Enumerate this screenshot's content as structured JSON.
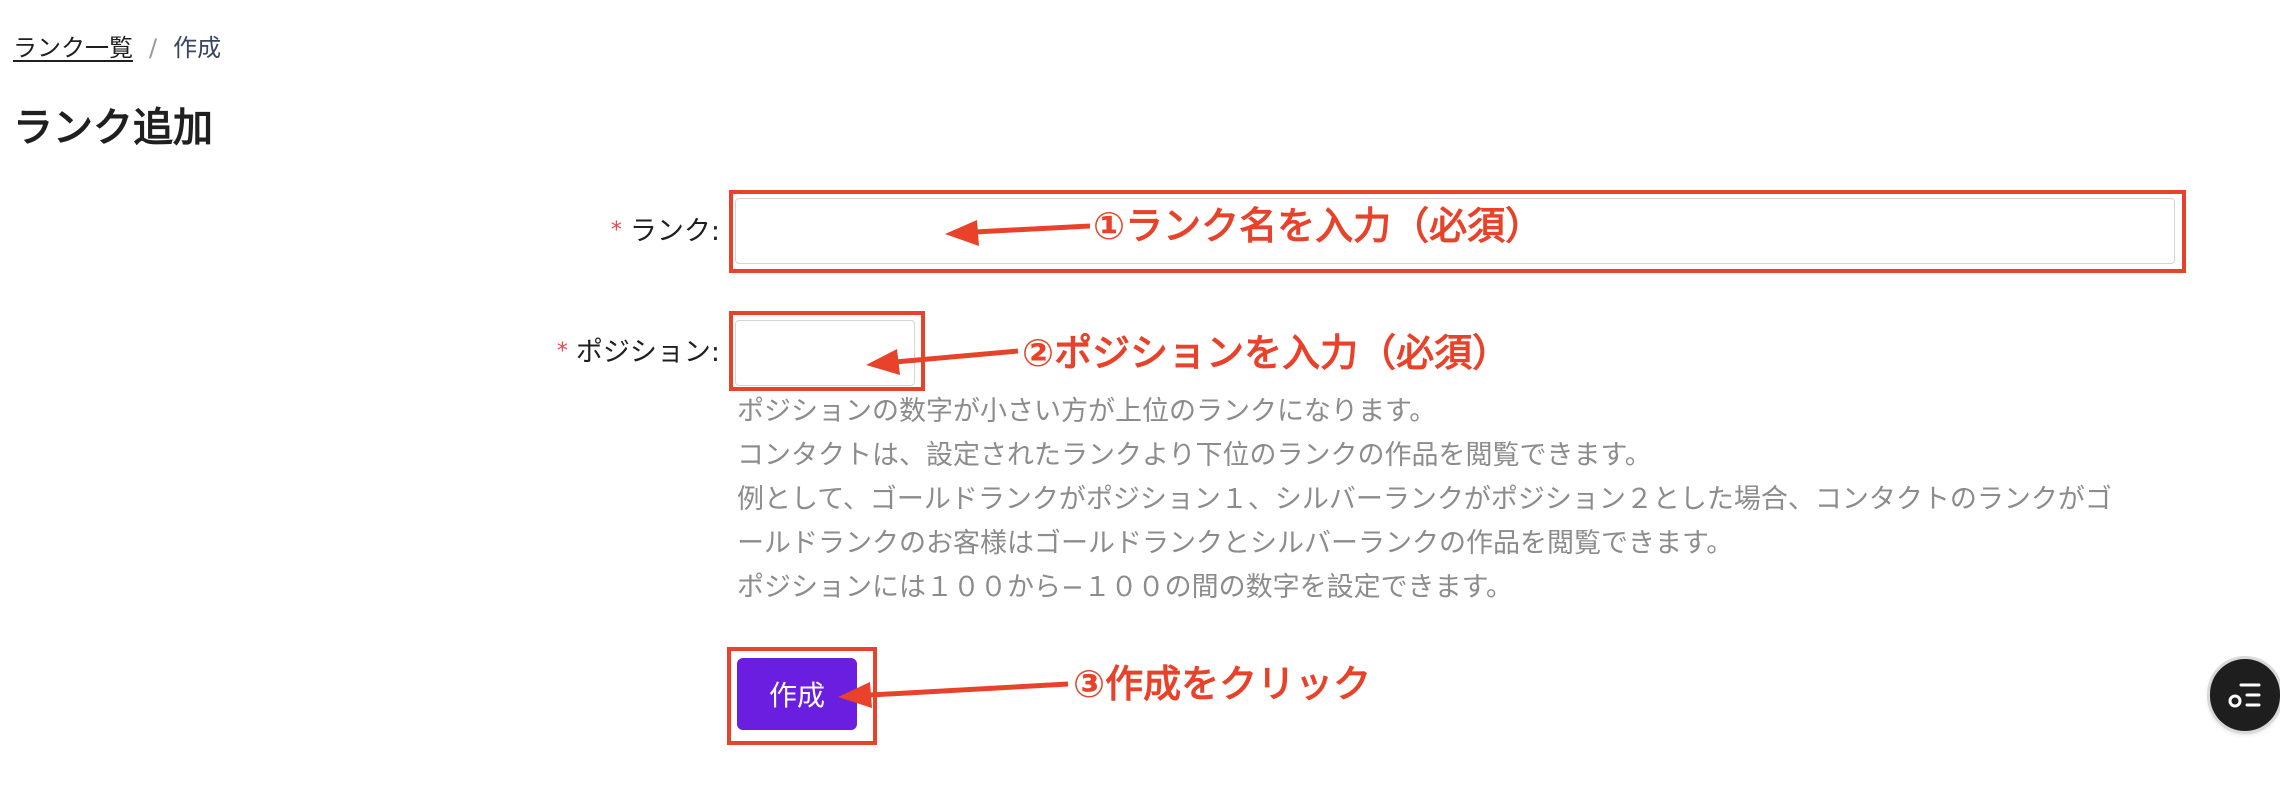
{
  "breadcrumb": {
    "parent": "ランク一覧",
    "separator": "/",
    "current": "作成"
  },
  "page_title": "ランク追加",
  "form": {
    "required_mark": "*",
    "rank_label": "ランク:",
    "rank_value": "",
    "position_label": "ポジション:",
    "position_value": "",
    "help_lines": [
      "ポジションの数字が小さい方が上位のランクになります。",
      "コンタクトは、設定されたランクより下位のランクの作品を閲覧できます。",
      "例として、ゴールドランクがポジション１、シルバーランクがポジション２とした場合、コンタクトのランクがゴ",
      "ールドランクのお客様はゴールドランクとシルバーランクの作品を閲覧できます。",
      "ポジションには１００から−１００の間の数字を設定できます。"
    ],
    "submit_label": "作成"
  },
  "annotations": {
    "step1": "①ランク名を入力（必須）",
    "step2": "②ポジションを入力（必須）",
    "step3": "③作成をクリック"
  },
  "colors": {
    "accent": "#6a1ee0",
    "annotation": "#e8432a",
    "required": "#e5484d",
    "help_text": "#8c8c8c"
  },
  "icons": {
    "floating_button": "list-menu-icon"
  }
}
